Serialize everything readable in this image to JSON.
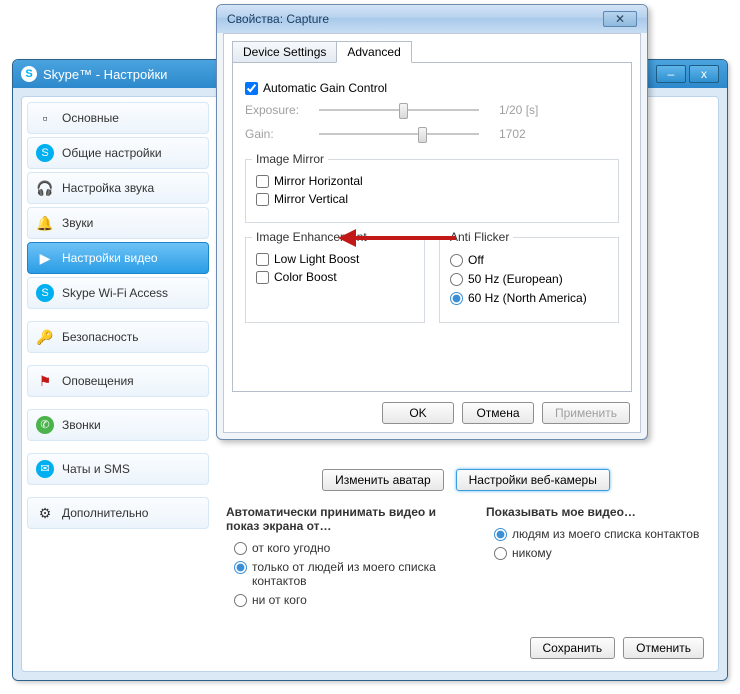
{
  "skype": {
    "title": "Skype™ - Настройки",
    "sidebar": [
      {
        "label": "Основные",
        "icon": "📋"
      },
      {
        "label": "Общие настройки",
        "icon": "S",
        "skype": true
      },
      {
        "label": "Настройка звука",
        "icon": "🎧"
      },
      {
        "label": "Звуки",
        "icon": "🔔"
      },
      {
        "label": "Настройки видео",
        "icon": "📷",
        "selected": true
      },
      {
        "label": "Skype Wi-Fi Access",
        "icon": "S",
        "skype": true
      }
    ],
    "sidebar2": [
      {
        "label": "Безопасность",
        "icon": "🔑"
      },
      {
        "label": "Оповещения",
        "icon": "🚩"
      },
      {
        "label": "Звонки",
        "icon": "📞",
        "green": true
      },
      {
        "label": "Чаты и SMS",
        "icon": "💬",
        "blue": true
      },
      {
        "label": "Дополнительно",
        "icon": "⚙"
      }
    ],
    "buttons": {
      "avatar": "Изменить аватар",
      "webcam": "Настройки веб-камеры"
    },
    "left_section": {
      "title": "Автоматически принимать видео и показ экрана от…",
      "opts": [
        "от кого угодно",
        "только от людей из моего списка контактов",
        "ни от кого"
      ],
      "sel": 1
    },
    "right_section": {
      "title": "Показывать мое видео…",
      "opts": [
        "людям из моего списка контактов",
        "никому"
      ],
      "sel": 0
    },
    "save": "Сохранить",
    "cancel": "Отменить"
  },
  "capture": {
    "title": "Свойства: Capture",
    "tabs": [
      "Device Settings",
      "Advanced"
    ],
    "active_tab": 1,
    "agc": {
      "label": "Automatic Gain Control",
      "checked": true
    },
    "exposure": {
      "label": "Exposure:",
      "value": "1/20 [s]",
      "pos": 50
    },
    "gain": {
      "label": "Gain:",
      "value": "1702",
      "pos": 62
    },
    "mirror": {
      "title": "Image Mirror",
      "h": {
        "label": "Mirror Horizontal",
        "checked": false
      },
      "v": {
        "label": "Mirror Vertical",
        "checked": false
      }
    },
    "enhance": {
      "title": "Image Enhancement",
      "low": {
        "label": "Low Light Boost",
        "checked": false
      },
      "color": {
        "label": "Color Boost",
        "checked": false
      }
    },
    "flicker": {
      "title": "Anti Flicker",
      "opts": [
        "Off",
        "50 Hz (European)",
        "60 Hz (North America)"
      ],
      "sel": 2
    },
    "ok": "OK",
    "cancel": "Отмена",
    "apply": "Применить"
  }
}
